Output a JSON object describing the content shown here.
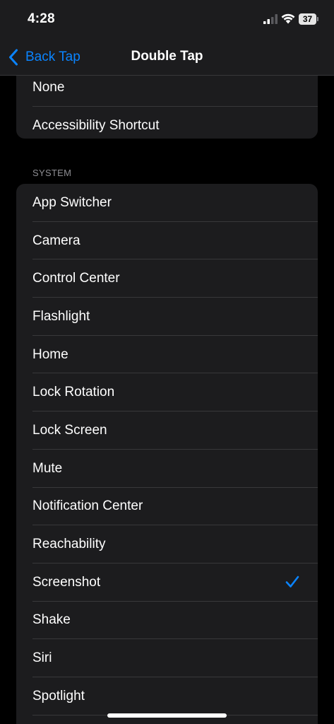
{
  "status_bar": {
    "time": "4:28",
    "battery_level": "37",
    "signal_icon": "cellular-signal-icon",
    "wifi_icon": "wifi-icon"
  },
  "nav": {
    "back_label": "Back Tap",
    "title": "Double Tap",
    "back_icon": "chevron-left-icon",
    "accent_color": "#0a84ff"
  },
  "top_group": {
    "items": [
      {
        "label": "None"
      },
      {
        "label": "Accessibility Shortcut"
      }
    ]
  },
  "system_section": {
    "header": "SYSTEM",
    "selected": "Screenshot",
    "items": [
      {
        "label": "App Switcher"
      },
      {
        "label": "Camera"
      },
      {
        "label": "Control Center"
      },
      {
        "label": "Flashlight"
      },
      {
        "label": "Home"
      },
      {
        "label": "Lock Rotation"
      },
      {
        "label": "Lock Screen"
      },
      {
        "label": "Mute"
      },
      {
        "label": "Notification Center"
      },
      {
        "label": "Reachability"
      },
      {
        "label": "Screenshot"
      },
      {
        "label": "Shake"
      },
      {
        "label": "Siri"
      },
      {
        "label": "Spotlight"
      },
      {
        "label": ""
      }
    ]
  }
}
